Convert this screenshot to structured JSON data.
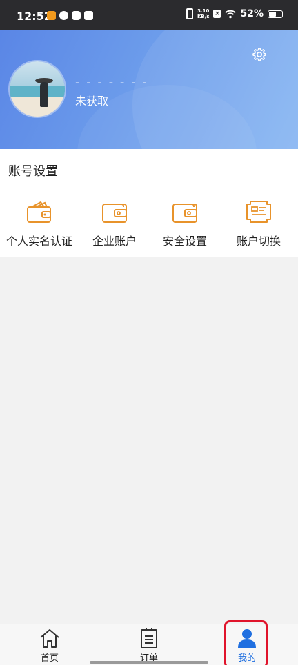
{
  "status_bar": {
    "time": "12:52",
    "net_speed_value": "3.10",
    "net_speed_unit": "KB/s",
    "battery": "52%"
  },
  "profile": {
    "username": "- - - - - - -",
    "status": "未获取"
  },
  "account_settings": {
    "title": "账号设置",
    "items": [
      {
        "label": "个人实名认证",
        "icon": "wallet-card-icon"
      },
      {
        "label": "企业账户",
        "icon": "wallet-icon"
      },
      {
        "label": "安全设置",
        "icon": "wallet-icon"
      },
      {
        "label": "账户切换",
        "icon": "receipt-icon"
      }
    ]
  },
  "tabbar": {
    "items": [
      {
        "label": "首页",
        "icon": "home-icon"
      },
      {
        "label": "订单",
        "icon": "clipboard-icon"
      },
      {
        "label": "我的",
        "icon": "person-icon",
        "selected": true
      }
    ]
  },
  "colors": {
    "accent": "#e8932b",
    "tab_selected": "#1f6fe0",
    "header_blue": "#6c9ceb",
    "highlight": "#e0142b"
  }
}
